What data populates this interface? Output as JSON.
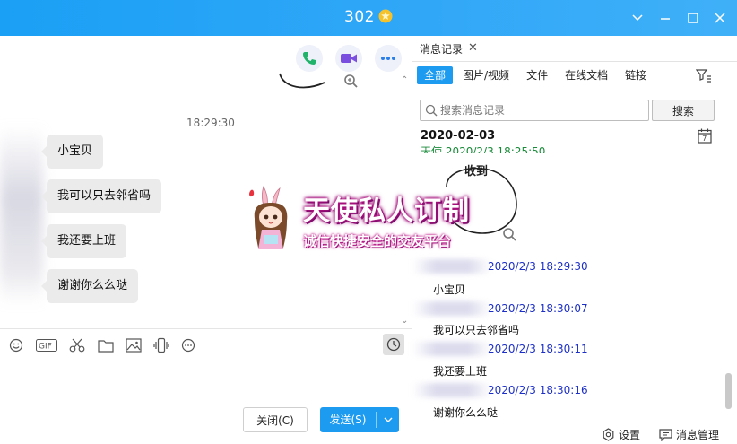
{
  "window": {
    "title": "302",
    "badge_icon": "gold-star-icon"
  },
  "chat": {
    "timestamp": "18:29:30",
    "messages": [
      {
        "text": "小宝贝"
      },
      {
        "text": "我可以只去邻省吗"
      },
      {
        "text": "我还要上班"
      },
      {
        "text": "谢谢你么么哒"
      }
    ],
    "toolbar_icons": [
      "emoji-icon",
      "gif-icon",
      "scissors-icon",
      "folder-icon",
      "image-icon",
      "shake-icon",
      "more-icon"
    ],
    "close_label": "关闭(C)",
    "send_label": "发送(S)"
  },
  "promo": {
    "line1": "天使私人订制",
    "line2": "诚信快捷安全的交友平台"
  },
  "history": {
    "tab_label": "消息记录",
    "filters": [
      {
        "label": "全部",
        "active": true
      },
      {
        "label": "图片/视频",
        "active": false
      },
      {
        "label": "文件",
        "active": false
      },
      {
        "label": "在线文档",
        "active": false
      },
      {
        "label": "链接",
        "active": false
      }
    ],
    "search_placeholder": "搜索消息记录",
    "search_button": "搜索",
    "date": "2020-02-03",
    "partial_line": "天使 2020/2/3 18:25:50",
    "sticker_text": "收到",
    "entries": [
      {
        "time": "2020/2/3 18:29:30",
        "text": "小宝贝"
      },
      {
        "time": "2020/2/3 18:30:07",
        "text": "我可以只去邻省吗"
      },
      {
        "time": "2020/2/3 18:30:11",
        "text": "我还要上班"
      },
      {
        "time": "2020/2/3 18:30:16",
        "text": "谢谢你么么哒"
      }
    ],
    "settings_label": "设置",
    "manage_label": "消息管理"
  },
  "colors": {
    "accent": "#1d9bf0",
    "timestamp_blue": "#1c2fc7",
    "promo_magenta": "#b0127e"
  }
}
